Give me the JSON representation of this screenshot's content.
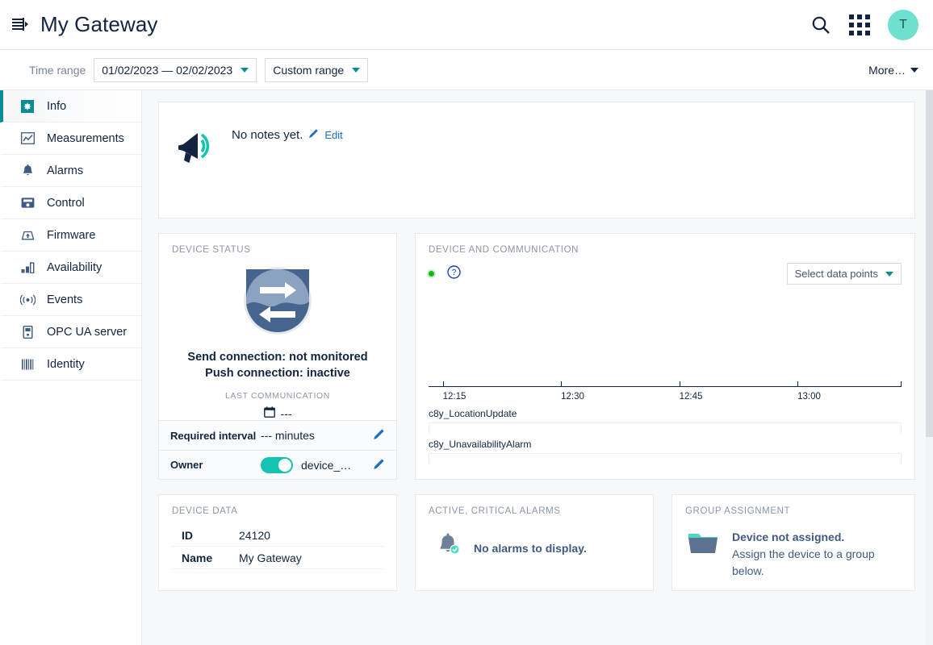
{
  "header": {
    "title": "My Gateway",
    "collapse_icon": "collapse-sidebar-icon",
    "search_icon": "search-icon",
    "apps_icon": "app-grid-icon",
    "avatar_initial": "T"
  },
  "toolbar": {
    "time_range_label": "Time range",
    "date_range_value": "01/02/2023 — 02/02/2023",
    "range_mode_value": "Custom range",
    "more_label": "More…"
  },
  "sidebar": {
    "items": [
      {
        "label": "Info",
        "icon": "info-badge-icon",
        "active": true
      },
      {
        "label": "Measurements",
        "icon": "line-chart-icon",
        "active": false
      },
      {
        "label": "Alarms",
        "icon": "bell-icon",
        "active": false
      },
      {
        "label": "Control",
        "icon": "control-device-icon",
        "active": false
      },
      {
        "label": "Firmware",
        "icon": "firmware-upload-icon",
        "active": false
      },
      {
        "label": "Availability",
        "icon": "bar-chart-icon",
        "active": false
      },
      {
        "label": "Events",
        "icon": "broadcast-icon",
        "active": false
      },
      {
        "label": "OPC UA server",
        "icon": "server-icon",
        "active": false
      },
      {
        "label": "Identity",
        "icon": "barcode-icon",
        "active": false
      }
    ]
  },
  "notes": {
    "icon": "megaphone-icon",
    "text": "No notes yet.",
    "edit_label": "Edit",
    "edit_icon": "pencil-icon"
  },
  "device_status": {
    "title": "DEVICE STATUS",
    "icon": "bidirectional-arrows-icon",
    "send_line": "Send connection: not monitored",
    "push_line": "Push connection: inactive",
    "last_communication_label": "LAST COMMUNICATION",
    "last_communication_value": "---",
    "calendar_icon": "calendar-icon",
    "rows": [
      {
        "key": "Required interval",
        "value": "--- minutes",
        "toggle": false,
        "edit_icon": "pencil-icon"
      },
      {
        "key": "Owner",
        "value": "device_…",
        "toggle": true,
        "edit_icon": "pencil-icon"
      }
    ]
  },
  "communication": {
    "title": "DEVICE AND COMMUNICATION",
    "status_dot": "green-status-dot",
    "help_icon": "help-circle-icon",
    "select_data_points_label": "Select data points",
    "chart_data": {
      "type": "timeline",
      "title": "DEVICE AND COMMUNICATION",
      "xlabel": "",
      "ylabel": "",
      "grid": false,
      "legend_position": "none",
      "x_tick_labels": [
        "12:15",
        "12:30",
        "12:45",
        "13:00"
      ],
      "x_tick_positions_pct": [
        3,
        28,
        53,
        78
      ],
      "series": [
        {
          "name": "c8y_LocationUpdate",
          "values": []
        },
        {
          "name": "c8y_UnavailabilityAlarm",
          "values": []
        }
      ]
    }
  },
  "device_data": {
    "title": "DEVICE DATA",
    "rows": [
      {
        "key": "ID",
        "value": "24120"
      },
      {
        "key": "Name",
        "value": "My Gateway"
      }
    ]
  },
  "alarms": {
    "title": "ACTIVE, CRITICAL ALARMS",
    "icon": "bell-check-icon",
    "empty_text": "No alarms to display."
  },
  "group_assignment": {
    "title": "GROUP ASSIGNMENT",
    "icon": "folder-icon",
    "line1": "Device not assigned.",
    "line2": "Assign the device to a group below."
  },
  "colors": {
    "accent_teal": "#0b8c94",
    "toggle_teal": "#12c4b0",
    "avatar_teal": "#6fe0cd",
    "link_blue": "#1b6fc4",
    "text_dark": "#12243f",
    "muted": "#8c96a6",
    "status_green": "#17b51c"
  }
}
